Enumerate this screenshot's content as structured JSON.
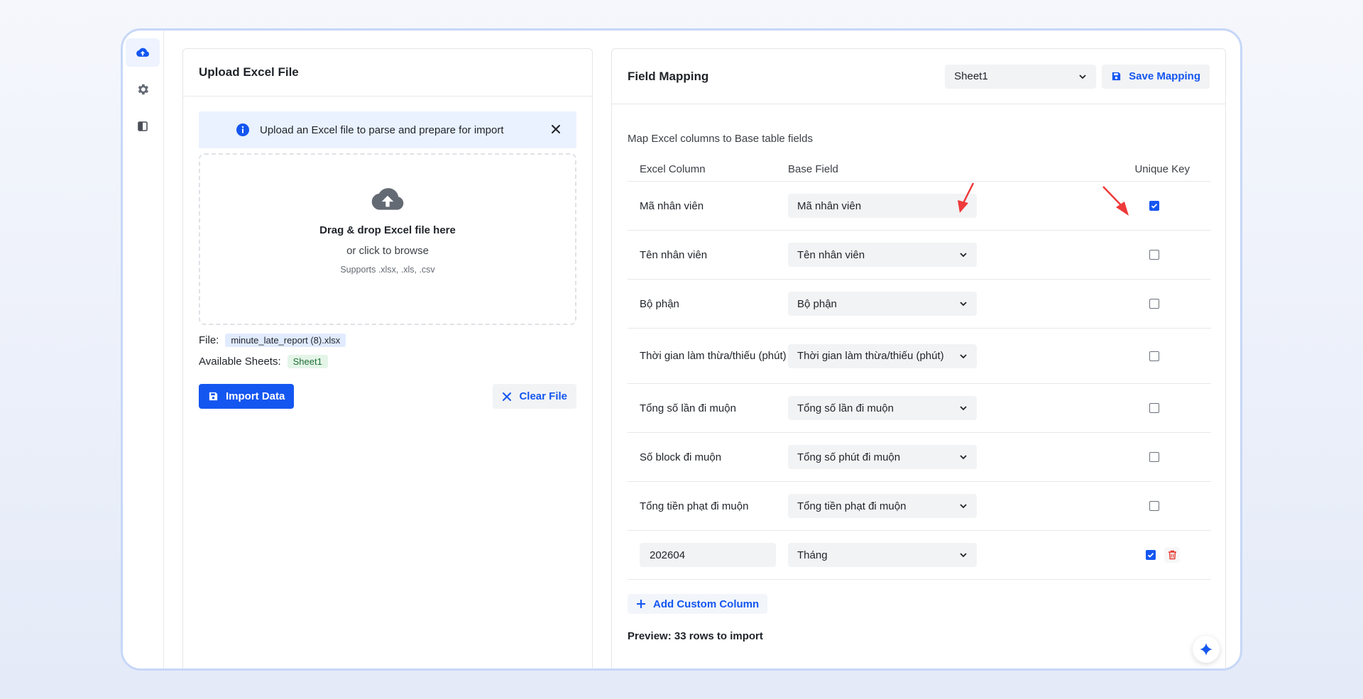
{
  "upload_panel": {
    "title": "Upload Excel File",
    "info_message": "Upload an Excel file to parse and prepare for import",
    "dropzone_title": "Drag & drop Excel file here",
    "dropzone_subtitle": "or click to browse",
    "dropzone_supports": "Supports .xlsx, .xls, .csv",
    "file_label": "File:",
    "file_name": "minute_late_report (8).xlsx",
    "sheets_label": "Available Sheets:",
    "sheets": [
      "Sheet1"
    ],
    "import_button": "Import Data",
    "clear_button": "Clear File"
  },
  "mapping_panel": {
    "title": "Field Mapping",
    "sheet_select": "Sheet1",
    "save_button": "Save Mapping",
    "subtitle": "Map Excel columns to Base table fields",
    "headers": {
      "excel_column": "Excel Column",
      "base_field": "Base Field",
      "unique_key": "Unique Key"
    },
    "rows": [
      {
        "excel": "Mã nhân viên",
        "base": "Mã nhân viên",
        "unique": true
      },
      {
        "excel": "Tên nhân viên",
        "base": "Tên nhân viên",
        "unique": false
      },
      {
        "excel": "Bộ phận",
        "base": "Bộ phận",
        "unique": false
      },
      {
        "excel": "Thời gian làm thừa/thiếu (phút)",
        "base": "Thời gian làm thừa/thiếu (phút)",
        "unique": false
      },
      {
        "excel": "Tổng số lần đi muộn",
        "base": "Tổng số lần đi muộn",
        "unique": false
      },
      {
        "excel": "Số block đi muộn",
        "base": "Tổng số phút đi muộn",
        "unique": false
      },
      {
        "excel": "Tổng tiền phạt đi muộn",
        "base": "Tổng tiền phạt đi muộn",
        "unique": false
      }
    ],
    "custom_row": {
      "value": "202604",
      "base": "Tháng",
      "unique": true
    },
    "add_custom_button": "Add Custom Column",
    "preview_text": "Preview: 33 rows to import"
  },
  "colors": {
    "accent": "#1456f0",
    "annotation_arrow": "#ee3a3a",
    "danger": "#e5382f"
  }
}
